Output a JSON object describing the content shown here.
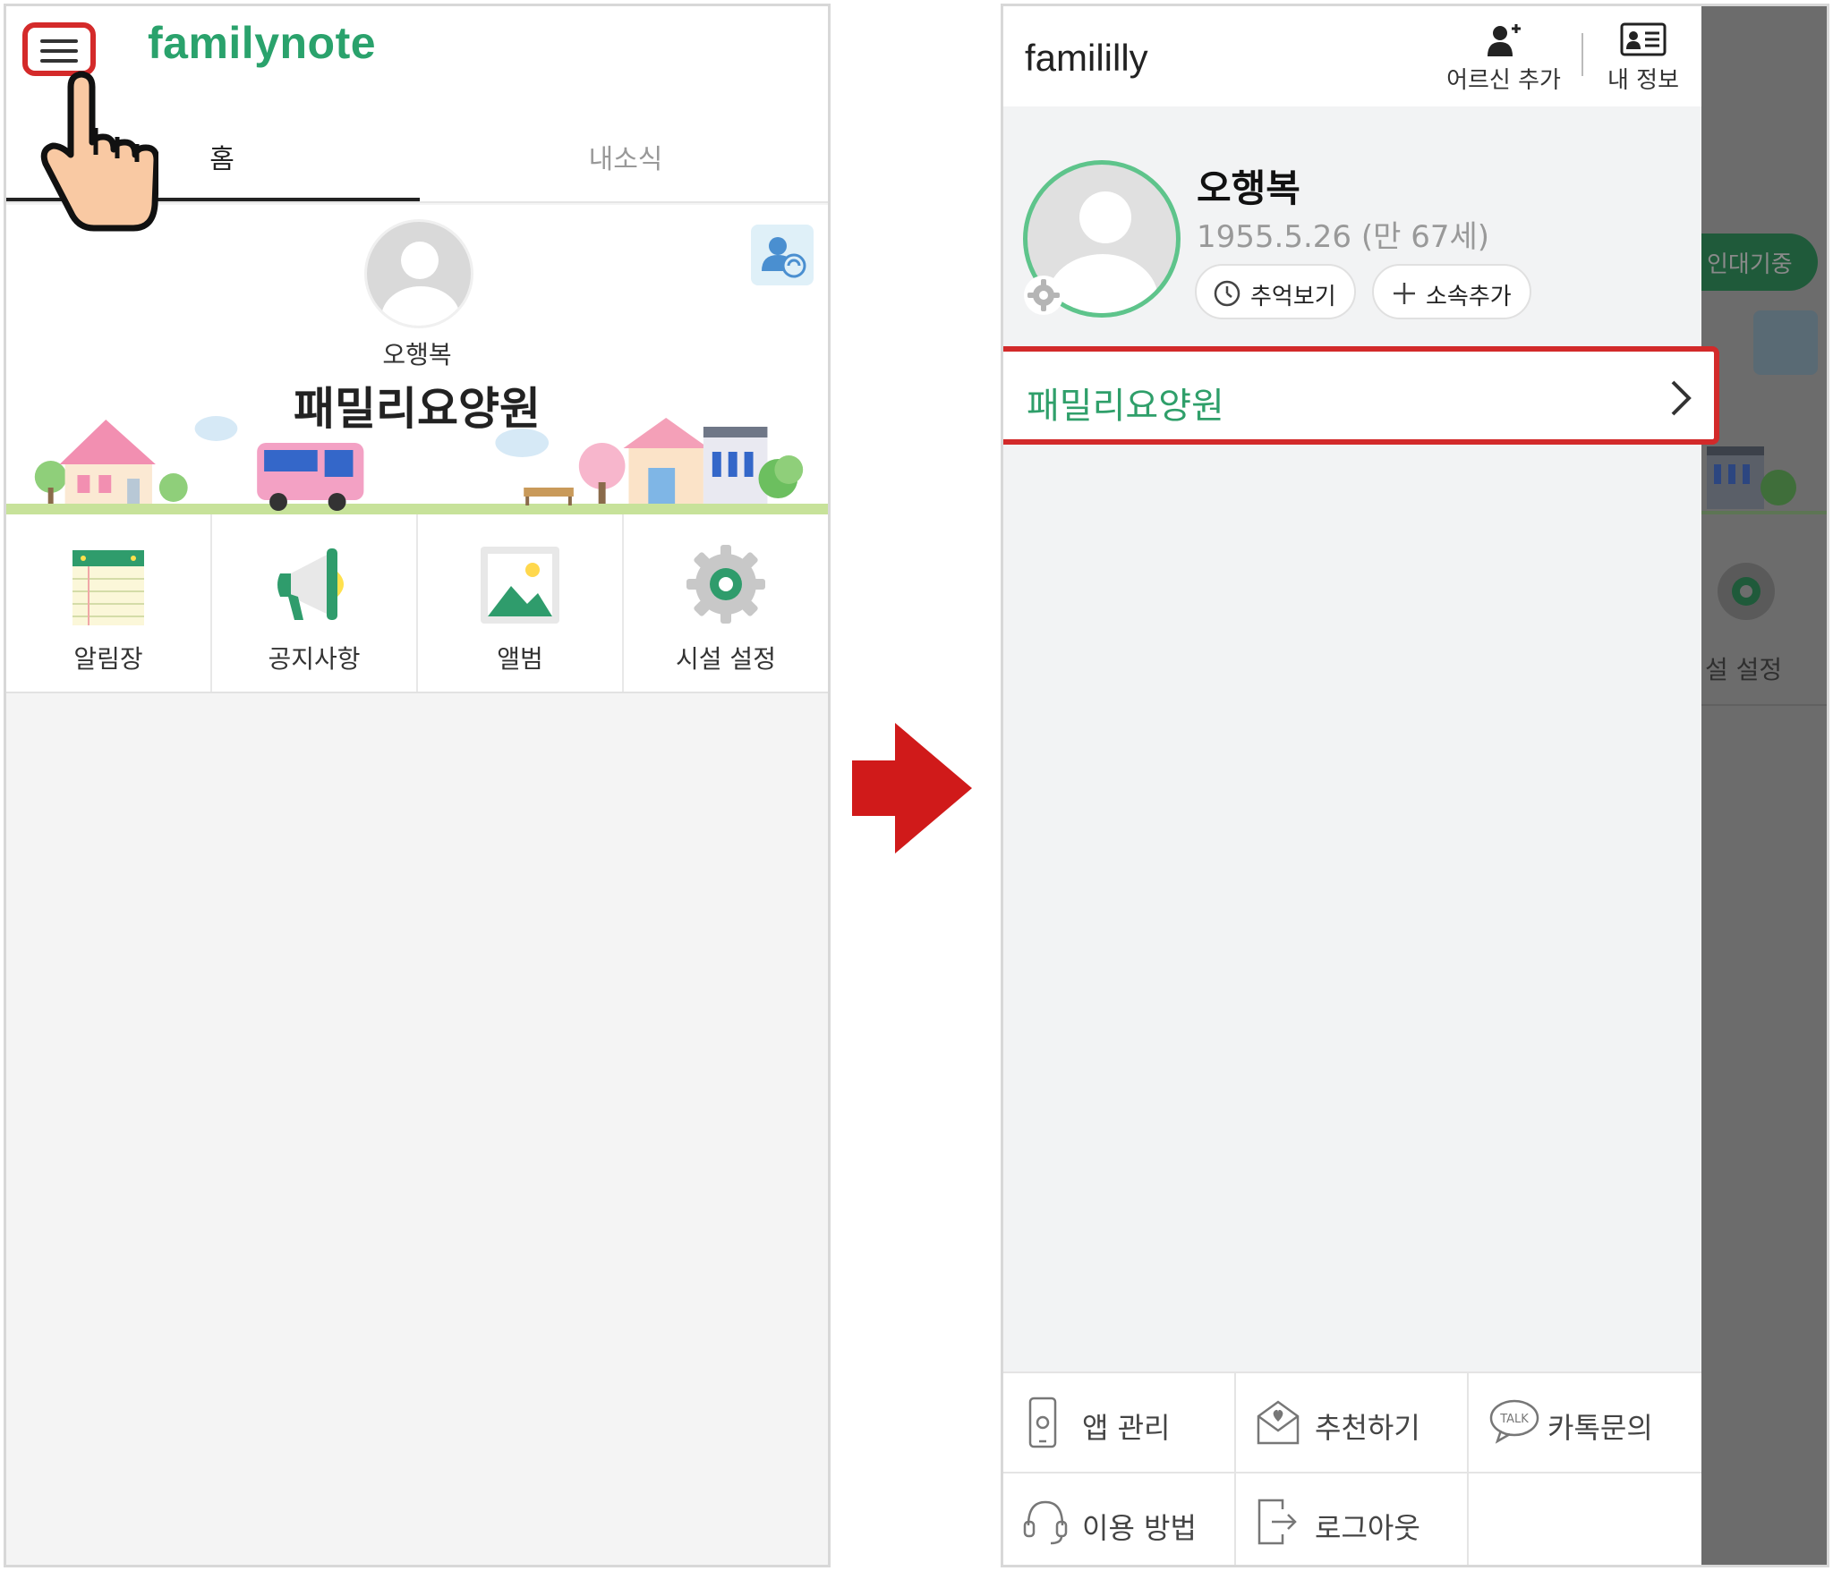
{
  "left": {
    "brand": "familynote",
    "tabs": {
      "home": "홈",
      "news": "내소식"
    },
    "profile": {
      "name": "오행복",
      "facility": "패밀리요양원"
    },
    "menu": [
      {
        "label": "알림장",
        "icon": "notebook-icon"
      },
      {
        "label": "공지사항",
        "icon": "megaphone-icon"
      },
      {
        "label": "앨범",
        "icon": "album-icon"
      },
      {
        "label": "시설 설정",
        "icon": "gear-icon"
      }
    ]
  },
  "right": {
    "brand": "famililly",
    "header": {
      "add_elder": "어르신 추가",
      "my_info": "내 정보"
    },
    "profile": {
      "name": "오행복",
      "birth": "1955.5.26 (만 67세)",
      "memory_button": "추억보기",
      "add_affiliation_button": "소속추가"
    },
    "facility_item": "패밀리요양원",
    "background": {
      "pill_text": "인대기중",
      "setting_text": "설 설정"
    },
    "bottom_menu": [
      {
        "label": "앱 관리",
        "icon": "phone-settings-icon"
      },
      {
        "label": "추천하기",
        "icon": "mail-heart-icon"
      },
      {
        "label": "카톡문의",
        "icon": "talk-bubble-icon"
      },
      {
        "label": "이용 방법",
        "icon": "headset-icon"
      },
      {
        "label": "로그아웃",
        "icon": "logout-icon"
      }
    ]
  },
  "colors": {
    "brand_green": "#2aa26c",
    "highlight_red": "#d22a2a",
    "arrow_red": "#d01a1a"
  }
}
